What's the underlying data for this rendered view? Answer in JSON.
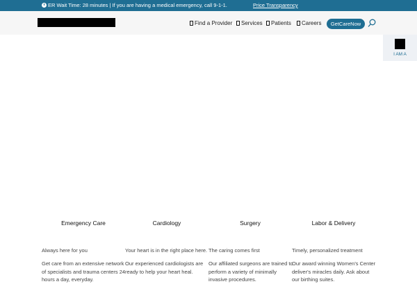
{
  "alert": {
    "text": "ER Wait Time: 28 minutes | If you are having a medical emergency, call 9-1-1.",
    "link": "Price Transparency"
  },
  "nav": {
    "items": [
      {
        "label": "Find a Provider"
      },
      {
        "label": "Services"
      },
      {
        "label": "Patients"
      },
      {
        "label": "Careers"
      }
    ],
    "cta": "GetCareNow"
  },
  "iam": {
    "label": "I AM A"
  },
  "services": [
    {
      "title": "Emergency Care",
      "tagline": "Always here for you",
      "description": "Get care from an extensive network of specialists and trauma centers 24 hours a day, everyday."
    },
    {
      "title": "Cardiology",
      "tagline": "Your heart is in the right place here.",
      "description": "Our experienced cardiologists are ready to help your heart heal."
    },
    {
      "title": "Surgery",
      "tagline": "The caring comes first",
      "description": "Our affiliated surgeons are trained to perform a variety of minimally invasive procedures."
    },
    {
      "title": "Labor & Delivery",
      "tagline": "Timely, personalized treatment",
      "description": "Our award winning Women's Center deliver's miracles daily. Ask about our birthing suites."
    }
  ],
  "colors": {
    "primary": "#1f6e93",
    "header_bg": "#f6f6f6",
    "tab_bg": "#eef1f5"
  }
}
